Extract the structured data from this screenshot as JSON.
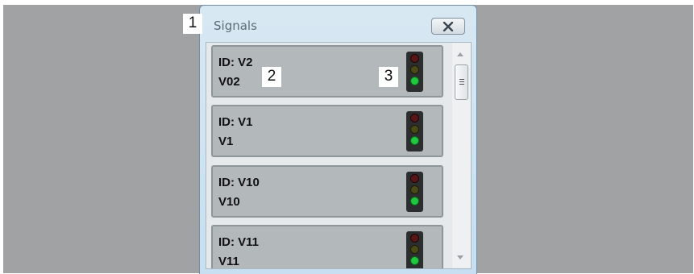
{
  "window": {
    "title": "Signals"
  },
  "signals": [
    {
      "id": "ID: V2",
      "name": "V02"
    },
    {
      "id": "ID: V1",
      "name": "V1"
    },
    {
      "id": "ID: V10",
      "name": "V10"
    },
    {
      "id": "ID: V11",
      "name": "V11"
    }
  ],
  "callouts": [
    "1",
    "2",
    "3"
  ],
  "icons": {
    "close": "close-icon",
    "traffic_light": "traffic-light-icon"
  },
  "colors": {
    "green_lamp": "#1fc83e",
    "background": "#a0a2a3",
    "window_frame": "#c7dff0"
  }
}
